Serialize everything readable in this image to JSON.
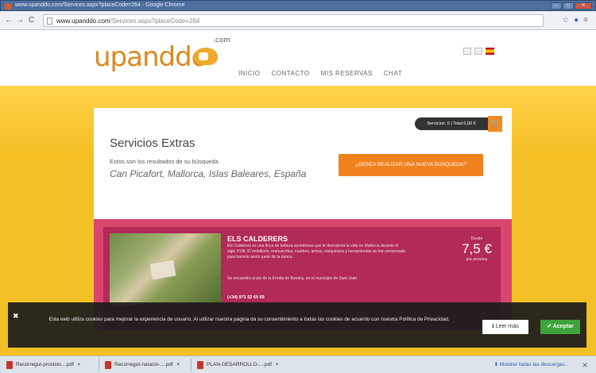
{
  "window": {
    "title": "www.upanddo.com/Services.aspx?placeCode=264 - Google Chrome",
    "controls": [
      "–",
      "□",
      "✕"
    ]
  },
  "addressbar": {
    "back": "←",
    "forward": "→",
    "reload": "C",
    "url_host": "www.upanddo.com",
    "url_path": "/Services.aspx?placeCode=264",
    "star": "☆",
    "ext": "●",
    "menu": "≡"
  },
  "site": {
    "logo_text": "upanddo",
    "logo_com": ".com",
    "nav": [
      "INICIO",
      "CONTACTO",
      "MIS RESERVAS",
      "CHAT"
    ]
  },
  "panel": {
    "title": "Servicios Extras",
    "subtitle": "Estos son los resultados de su búsqueda",
    "location": "Can Picafort, Mallorca, Islas Baleares, España",
    "cart_summary": "Servicios: 0 | Total 0,00 €",
    "cart_icon": "🛒",
    "new_search_label": "¿DESEA REALIZAR UNA NUEVA BÚSQUEDA?"
  },
  "result": {
    "title": "ELS CALDERERS",
    "description": "Els Calderers es una finca de belleza asombrosa que le descubrirá la vida en Mallorca durante el siglo XVIII. El mobiliario, manuscritos, cuadros, armas, maquinaria y herramientas se han preservado para hacerle sentir parte de la época.",
    "location": "Se encuentra al pie de la Ermita de Bonany, en el municipio de Sant Joan.",
    "phone": "(+34) 971 52 60 69",
    "price_prefix": "Desde",
    "price": "7,5 €",
    "price_unit": "por persona"
  },
  "cookie": {
    "close": "✖",
    "text": "Esta web utiliza cookies para mejorar la experiencia de usuario. Al utilizar nuestra página da su consentimiento a todas las cookies de acuerdo con nuestra Política de Privacidad.",
    "more_label": "ℹ Leer más",
    "accept_label": "✔ Aceptar"
  },
  "downloads": {
    "items": [
      {
        "name": "Recorregut-provisio....pdf"
      },
      {
        "name": "Recorregut-natacio-....pdf"
      },
      {
        "name": "PLAN-DESARROLLO-....pdf"
      }
    ],
    "caret": "▾",
    "show_all": "⬇ Mostrar todas las descargas...",
    "close": "✕"
  },
  "colors": {
    "brand_orange": "#f0821e",
    "yellow": "#f3c126",
    "pink": "#d8466e",
    "accept_green": "#3da33a"
  }
}
